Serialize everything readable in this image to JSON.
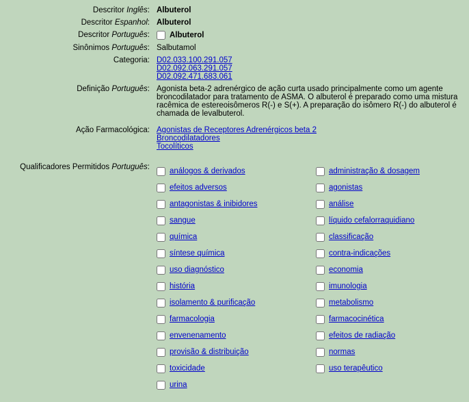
{
  "labels": {
    "desc_en": "Descritor",
    "desc_en_lang": "Inglês",
    "desc_es": "Descritor",
    "desc_es_lang": "Espanhol",
    "desc_pt": "Descritor",
    "desc_pt_lang": "Português",
    "syn_pt": "Sinônimos",
    "syn_pt_lang": "Português",
    "cat": "Categoria",
    "def_pt": "Definição",
    "def_pt_lang": "Português",
    "pharm": "Ação Farmacológica",
    "qual": "Qualificadores Permitidos",
    "qual_lang": "Português"
  },
  "values": {
    "desc_en": "Albuterol",
    "desc_es": "Albuterol",
    "desc_pt": "Albuterol",
    "syn_pt": "Salbutamol",
    "definition": "Agonista beta-2 adrenérgico de ação curta usado principalmente como um agente broncodilatador para tratamento de ASMA. O albuterol é preparado como uma mistura racêmica de estereoisômeros R(-) e S(+). A preparação do isômero R(-) do albuterol é chamada de levalbuterol."
  },
  "categories": [
    "D02.033.100.291.057",
    "D02.092.063.291.057",
    "D02.092.471.683.061"
  ],
  "pharm_actions": [
    "Agonistas de Receptores Adrenérgicos beta 2",
    "Broncodilatadores",
    "Tocolíticos"
  ],
  "qualifiers_left": [
    "análogos & derivados",
    "efeitos adversos",
    "antagonistas & inibidores",
    "sangue",
    "química",
    "síntese química",
    "uso diagnóstico",
    "história",
    "isolamento & purificação",
    "farmacologia",
    "envenenamento",
    "provisão & distribuição",
    "toxicidade",
    "urina"
  ],
  "qualifiers_right": [
    "administração & dosagem",
    "agonistas",
    "análise",
    "líquido cefalorraquidiano",
    "classificação",
    "contra-indicações",
    "economia",
    "imunologia",
    "metabolismo",
    "farmacocinética",
    "efeitos de radiação",
    "normas",
    "uso terapêutico"
  ]
}
